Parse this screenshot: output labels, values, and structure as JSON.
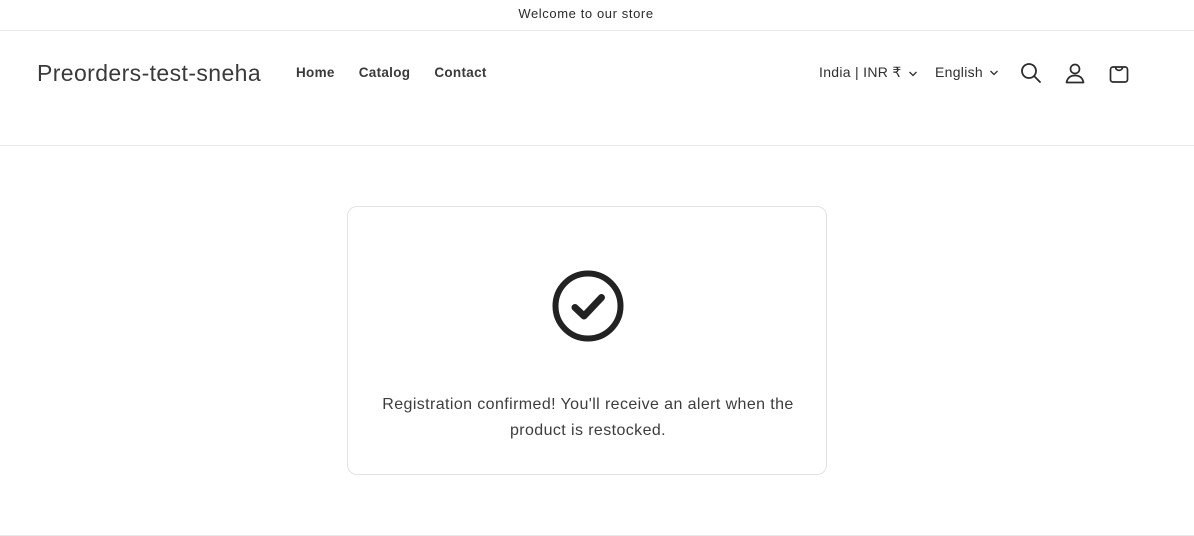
{
  "announcement": {
    "text": "Welcome to our store"
  },
  "header": {
    "logo": "Preorders-test-sneha",
    "nav": [
      {
        "label": "Home"
      },
      {
        "label": "Catalog"
      },
      {
        "label": "Contact"
      }
    ],
    "country_selector": "India | INR ₹",
    "language_selector": "English",
    "icons": [
      "search-icon",
      "account-icon",
      "cart-icon"
    ]
  },
  "card": {
    "icon": "check-circle-icon",
    "message": "Registration confirmed! You'll receive an alert when the product is restocked."
  }
}
